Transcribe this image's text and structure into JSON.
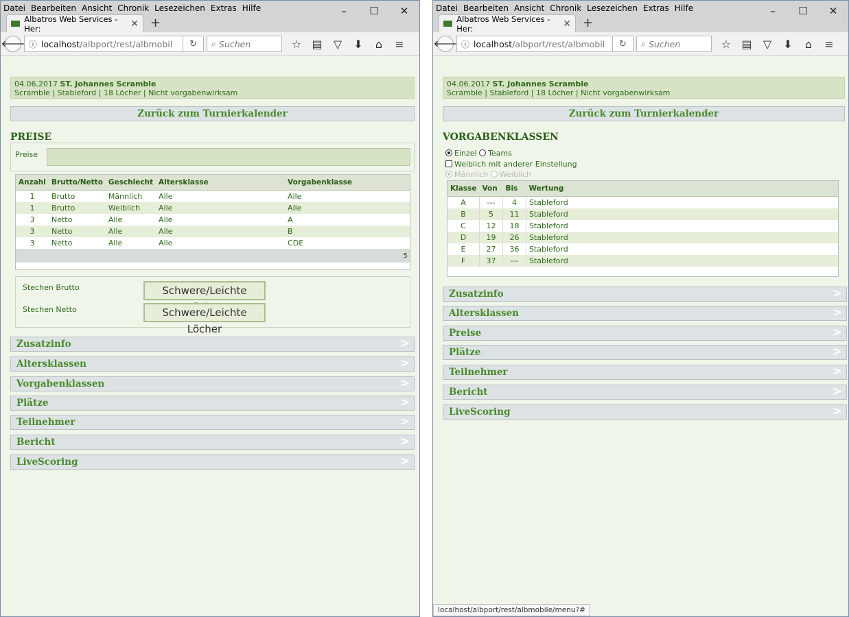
{
  "menu": [
    "Datei",
    "Bearbeiten",
    "Ansicht",
    "Chronik",
    "Lesezeichen",
    "Extras",
    "Hilfe"
  ],
  "window_controls": {
    "minimize": "–",
    "maximize": "☐",
    "close": "✕"
  },
  "tab": {
    "title": "Albatros Web Services - Her:",
    "close": "✕",
    "new": "+"
  },
  "url": {
    "host": "localhost",
    "path": "/albport/rest/albmobil"
  },
  "search_placeholder": "Suchen",
  "tournament": {
    "date": "04.06.2017",
    "name": "ST. Johannes Scramble",
    "details": "Scramble  |  Stableford  |  18 Löcher  |  Nicht vorgabenwirksam"
  },
  "back_label": "Zurück zum Turnierkalender",
  "left": {
    "section_title": "PREISE",
    "preise_label": "Preise",
    "prize_table": {
      "headers": [
        "Anzahl",
        "Brutto/Netto",
        "Geschlecht",
        "Altersklasse",
        "Vorgabenklasse"
      ],
      "rows": [
        [
          "1",
          "Brutto",
          "Männlich",
          "Alle",
          "Alle"
        ],
        [
          "1",
          "Brutto",
          "Weiblich",
          "Alle",
          "Alle"
        ],
        [
          "3",
          "Netto",
          "Alle",
          "Alle",
          "A"
        ],
        [
          "3",
          "Netto",
          "Alle",
          "Alle",
          "B"
        ],
        [
          "3",
          "Netto",
          "Alle",
          "Alle",
          "CDE"
        ]
      ],
      "count": "5"
    },
    "stechen_brutto": "Stechen Brutto",
    "stechen_netto": "Stechen Netto",
    "stechen_value": "Schwere/Leichte Löcher",
    "accordion": [
      "Zusatzinfo",
      "Altersklassen",
      "Vorgabenklassen",
      "Plätze",
      "Teilnehmer",
      "Bericht",
      "LiveScoring"
    ]
  },
  "right": {
    "section_title": "VORGABENKLASSEN",
    "radio_einzel": "Einzel",
    "radio_teams": "Teams",
    "checkbox_label": "Weiblich mit anderer Einstellung",
    "radio_maennlich": "Männlich",
    "radio_weiblich": "Weiblich",
    "class_table": {
      "headers": [
        "Klasse",
        "Von",
        "Bis",
        "Wertung"
      ],
      "rows": [
        [
          "A",
          "---",
          "4",
          "Stableford"
        ],
        [
          "B",
          "5",
          "11",
          "Stableford"
        ],
        [
          "C",
          "12",
          "18",
          "Stableford"
        ],
        [
          "D",
          "19",
          "26",
          "Stableford"
        ],
        [
          "E",
          "27",
          "36",
          "Stableford"
        ],
        [
          "F",
          "37",
          "---",
          "Stableford"
        ]
      ]
    },
    "accordion": [
      "Zusatzinfo",
      "Altersklassen",
      "Preise",
      "Plätze",
      "Teilnehmer",
      "Bericht",
      "LiveScoring"
    ],
    "status_url": "localhost/albport/rest/albmobile/menu?#"
  },
  "chevron": ">"
}
